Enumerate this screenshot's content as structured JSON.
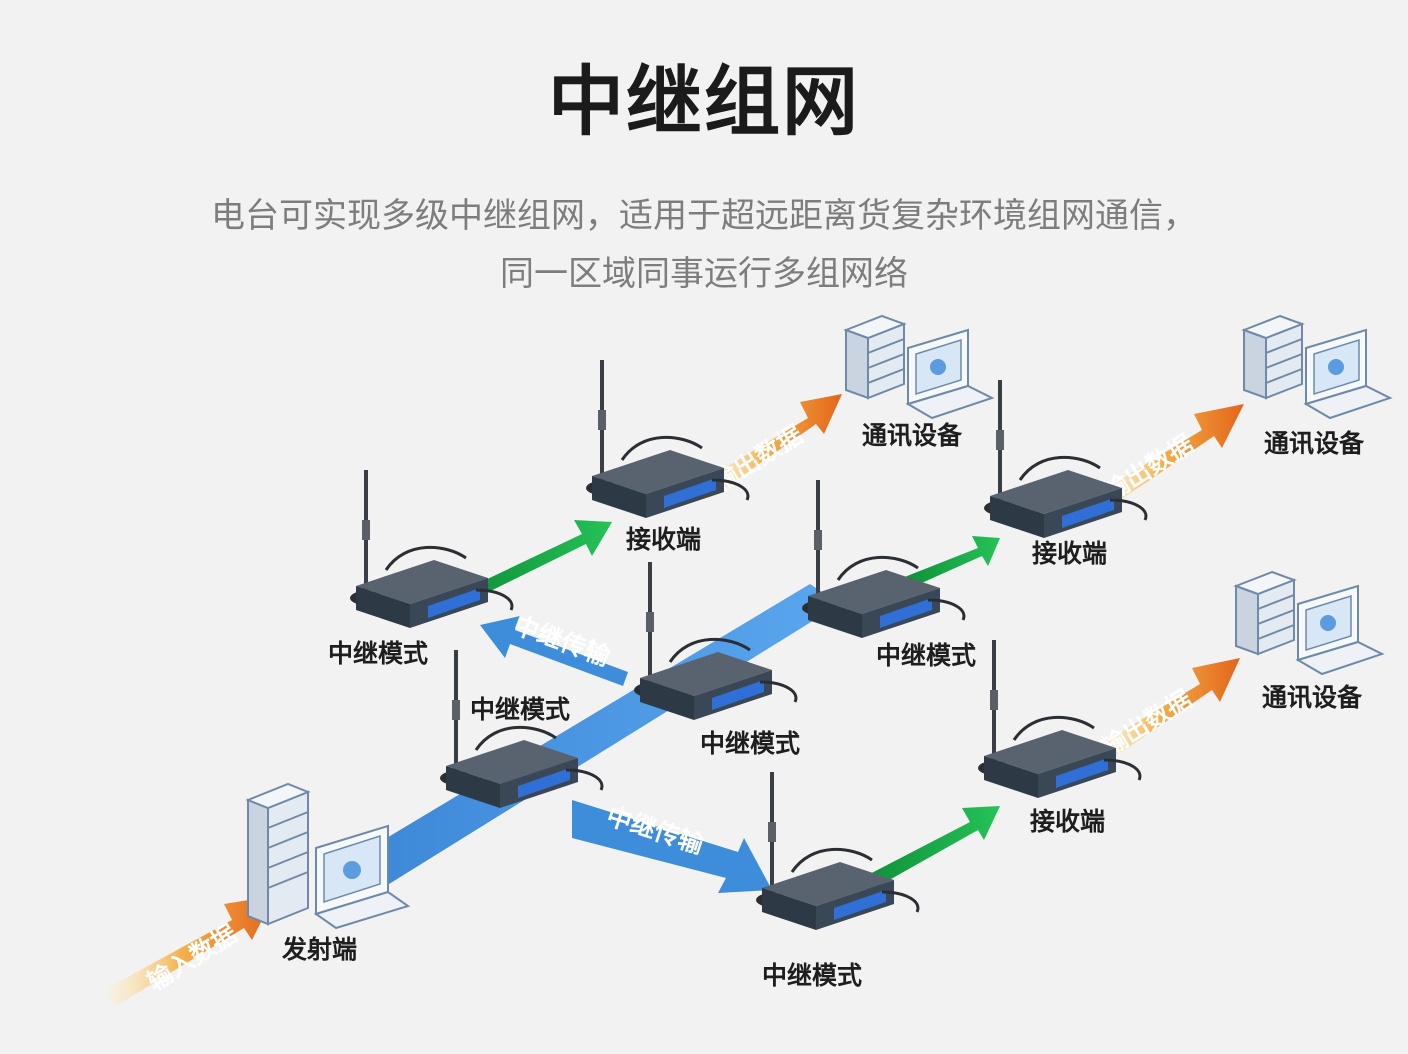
{
  "title": "中继组网",
  "subtitle": {
    "line1": "电台可实现多级中继组网，适用于超远距离货复杂环境组网通信，",
    "line2": "同一区域同事运行多组网络"
  },
  "labels": {
    "transmitter": "发射端",
    "input_data": "输入数据",
    "relay_mode": "中继模式",
    "relay_transmit": "中继传输",
    "receiver": "接收端",
    "output_data": "输出数据",
    "comm_device": "通讯设备"
  },
  "colors": {
    "background": "#f2f2f2",
    "title": "#1b1b1b",
    "subtitle": "#7d7d7d",
    "relay_band": "#3d8ddb",
    "green_arrow": "#1aa845",
    "orange_arrow": "#e8741c",
    "device_body": "#2d3a4a",
    "device_panel": "#2f6fd6"
  }
}
